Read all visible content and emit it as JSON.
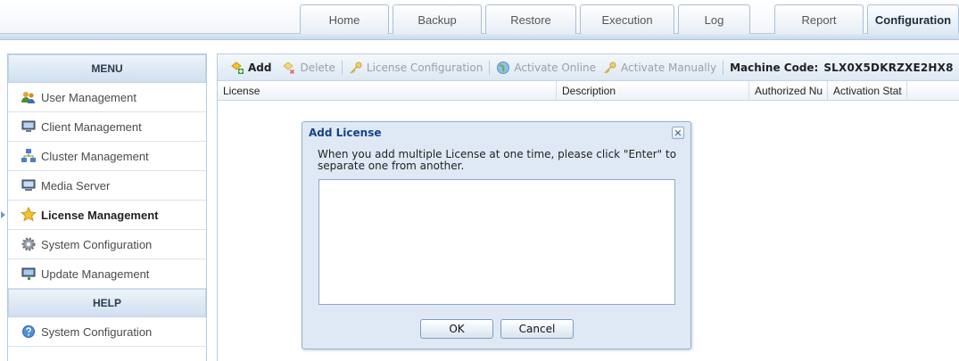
{
  "tabs": [
    {
      "label": "Home"
    },
    {
      "label": "Backup"
    },
    {
      "label": "Restore"
    },
    {
      "label": "Execution"
    },
    {
      "label": "Log"
    },
    {
      "label": "Report"
    },
    {
      "label": "Configuration",
      "active": true
    }
  ],
  "sidebar": {
    "menu_header": "MENU",
    "items": [
      {
        "label": "User Management",
        "icon": "users-icon"
      },
      {
        "label": "Client Management",
        "icon": "computer-icon"
      },
      {
        "label": "Cluster Management",
        "icon": "cluster-icon"
      },
      {
        "label": "Media Server",
        "icon": "server-icon"
      },
      {
        "label": "License Management",
        "icon": "star-icon",
        "active": true
      },
      {
        "label": "System Configuration",
        "icon": "gear-icon"
      },
      {
        "label": "Update Management",
        "icon": "update-icon"
      }
    ],
    "help_header": "HELP",
    "help_items": [
      {
        "label": "System Configuration",
        "icon": "help-icon"
      }
    ]
  },
  "toolbar": {
    "add_label": "Add",
    "delete_label": "Delete",
    "license_config_label": "License Configuration",
    "activate_online_label": "Activate Online",
    "activate_manually_label": "Activate Manually",
    "machine_code_label": "Machine Code:",
    "machine_code_value": "SLX0X5DKRZXE2HX8"
  },
  "grid": {
    "columns": [
      "License",
      "Description",
      "Authorized Nu",
      "Activation Stat"
    ]
  },
  "dialog": {
    "title": "Add License",
    "message": "When you add multiple License at one time, please click \"Enter\" to separate one from another.",
    "textarea_value": "",
    "ok_label": "OK",
    "cancel_label": "Cancel"
  },
  "colors": {
    "accent": "#15428b",
    "header_gradient_top": "#eef4fa",
    "header_gradient_bottom": "#cfdff0",
    "border": "#b6cbe0"
  }
}
